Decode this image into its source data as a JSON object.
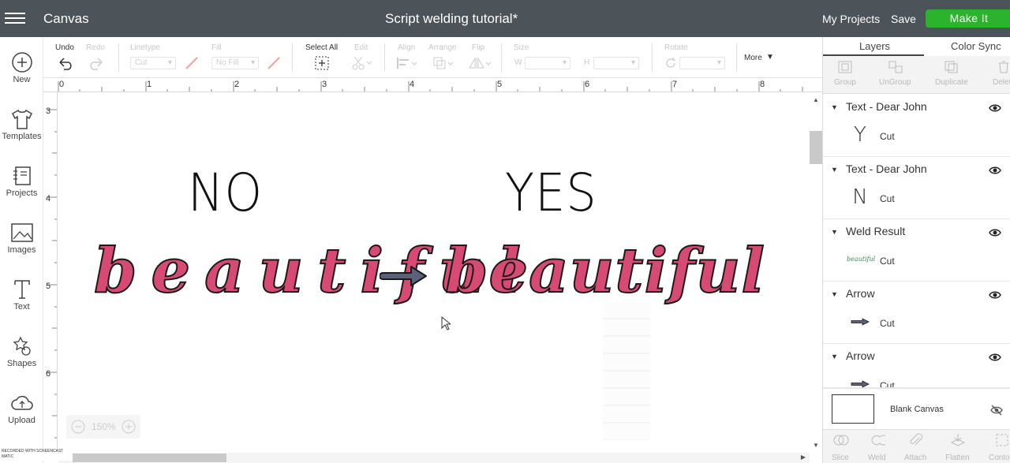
{
  "header": {
    "app_name": "Canvas",
    "doc_title": "Script welding tutorial*",
    "my_projects": "My Projects",
    "save": "Save",
    "make_it": "Make It"
  },
  "leftnav": [
    {
      "label": "New",
      "icon": "plus-circle-icon"
    },
    {
      "label": "Templates",
      "icon": "shirt-icon"
    },
    {
      "label": "Projects",
      "icon": "notebook-icon"
    },
    {
      "label": "Images",
      "icon": "image-icon"
    },
    {
      "label": "Text",
      "icon": "text-icon"
    },
    {
      "label": "Shapes",
      "icon": "shapes-icon"
    },
    {
      "label": "Upload",
      "icon": "cloud-upload-icon"
    }
  ],
  "toolbar": {
    "undo": "Undo",
    "redo": "Redo",
    "linetype": "Linetype",
    "linetype_value": "Cut",
    "fill": "Fill",
    "fill_value": "No Fill",
    "select_all": "Select All",
    "edit": "Edit",
    "align": "Align",
    "arrange": "Arrange",
    "flip": "Flip",
    "size": "Size",
    "w": "W",
    "h": "H",
    "rotate": "Rotate",
    "more": "More"
  },
  "ruler": {
    "h": [
      "0",
      "1",
      "2",
      "3",
      "4",
      "5",
      "6",
      "7",
      "8"
    ],
    "v": [
      "3",
      "4",
      "5",
      "6"
    ]
  },
  "canvas": {
    "no": "NO",
    "yes": "YES",
    "word_left": "beautiful",
    "word_right": "beautiful",
    "zoom": "150%",
    "watermark": "RECORDED WITH SCREENCAST MATIC"
  },
  "panel": {
    "tabs": [
      "Layers",
      "Color Sync"
    ],
    "actions": [
      "Group",
      "UnGroup",
      "Duplicate",
      "Delete"
    ],
    "layers": [
      {
        "name": "Text - Dear John",
        "type": "Cut",
        "thumb": "Y"
      },
      {
        "name": "Text - Dear John",
        "type": "Cut",
        "thumb": "N"
      },
      {
        "name": "Weld Result",
        "type": "Cut",
        "thumb": "beautiful"
      },
      {
        "name": "Arrow",
        "type": "Cut",
        "thumb": ""
      },
      {
        "name": "Arrow",
        "type": "Cut",
        "thumb": ""
      }
    ],
    "blank_canvas": "Blank Canvas",
    "bottom_actions": [
      "Slice",
      "Weld",
      "Attach",
      "Flatten",
      "Contour"
    ]
  },
  "colors": {
    "topbar": "#4c5359",
    "make_it": "#2bb32d",
    "script_fill": "#d64a73",
    "arrow": "#5a6178"
  }
}
